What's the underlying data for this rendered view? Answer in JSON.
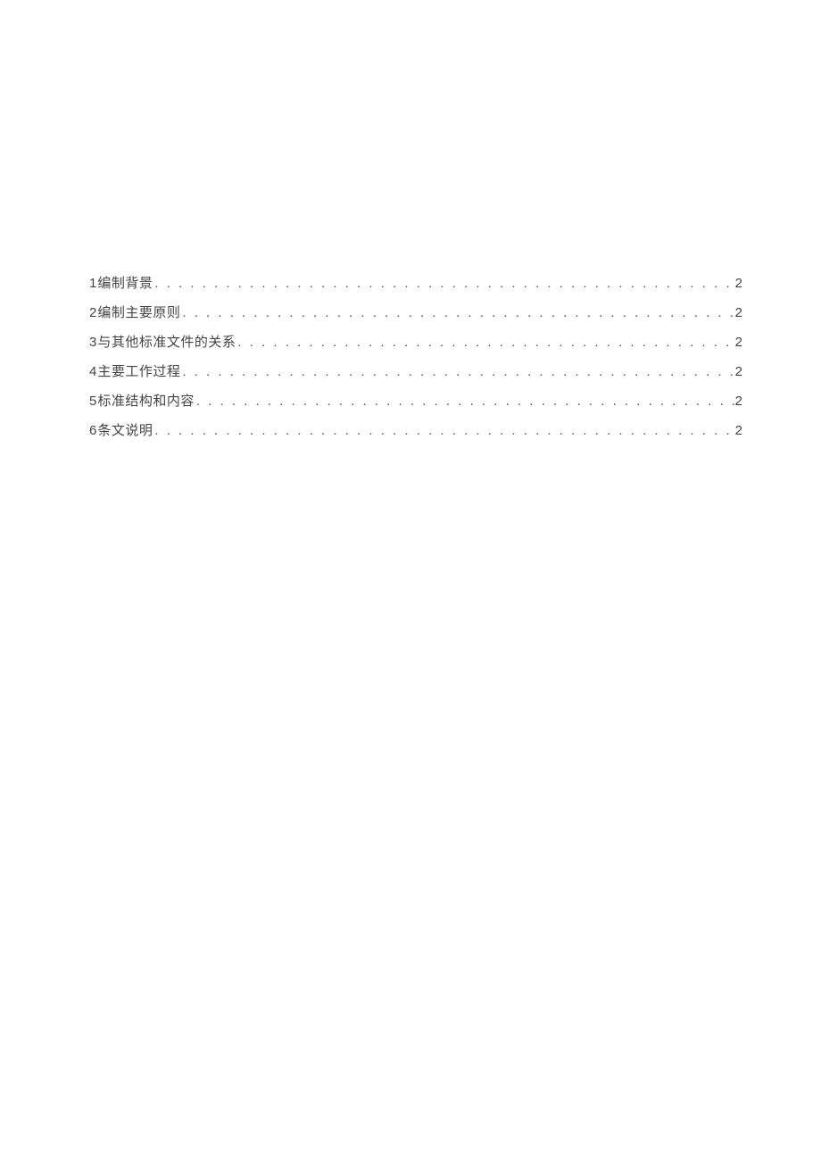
{
  "toc": {
    "entries": [
      {
        "num": "1",
        "title": "编制背景",
        "page": "2"
      },
      {
        "num": "2",
        "title": "编制主要原则",
        "page": "2"
      },
      {
        "num": "3",
        "title": "与其他标准文件的关系",
        "page": "2"
      },
      {
        "num": "4",
        "title": "主要工作过程",
        "page": "2"
      },
      {
        "num": "5",
        "title": "标准结构和内容",
        "page": "2"
      },
      {
        "num": "6",
        "title": "条文说明",
        "page": "2"
      }
    ]
  },
  "dots": ". . . . . . . . . . . . . . . . . . . . . . . . . . . . . . . . . . . . . . . . . . . . . . . . . . . . . . . . . . . . . . . . . . . . . . . . . . . . . . . . . . . . . . . . . . . . . . . . . . . . . . . . . . . . . . . . . . . . . . . . . . . . . . . . . . . . . . . . . . . . . . . . . . . . . . . . . . . . . . . ."
}
